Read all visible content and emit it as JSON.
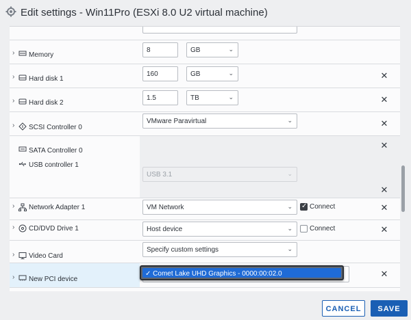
{
  "dialog": {
    "title": "Edit settings - Win11Pro (ESXi 8.0 U2 virtual machine)"
  },
  "devices": {
    "memory": {
      "label": "Memory",
      "value": "8",
      "unit": "GB"
    },
    "hard_disk_1": {
      "label": "Hard disk 1",
      "value": "160",
      "unit": "GB"
    },
    "hard_disk_2": {
      "label": "Hard disk 2",
      "value": "1.5",
      "unit": "TB"
    },
    "scsi_controller": {
      "label": "SCSI Controller 0",
      "value": "VMware Paravirtual"
    },
    "sata_controller": {
      "label": "SATA Controller 0"
    },
    "usb_controller": {
      "label": "USB controller 1",
      "value": "USB 3.1"
    },
    "network_adapter": {
      "label": "Network Adapter 1",
      "value": "VM Network",
      "connect_label": "Connect",
      "connected": true
    },
    "cd_dvd": {
      "label": "CD/DVD Drive 1",
      "value": "Host device",
      "connect_label": "Connect",
      "connected": false
    },
    "video_card": {
      "label": "Video Card",
      "value": "Specify custom settings"
    },
    "new_pci": {
      "label": "New PCI device",
      "selected_option": "Comet Lake UHD Graphics - 0000:00:02.0"
    }
  },
  "icons": {
    "remove": "✕",
    "chevron": "›",
    "caret": "⌄",
    "check": "✓"
  },
  "footer": {
    "cancel_label": "CANCEL",
    "save_label": "SAVE"
  },
  "colors": {
    "accent": "#1a5fb4",
    "selected_row": "#e3f1fb",
    "dropdown_highlight": "#1f6bd6"
  }
}
